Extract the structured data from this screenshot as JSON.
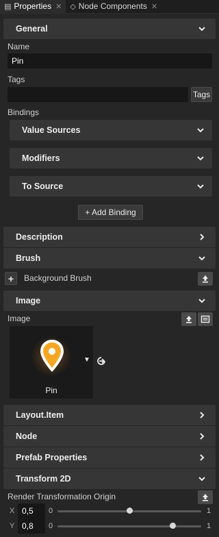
{
  "tabs": [
    {
      "label": "Properties",
      "active": true
    },
    {
      "label": "Node Components",
      "active": false
    }
  ],
  "sections": {
    "general": "General",
    "description": "Description",
    "brush": "Brush",
    "image": "Image",
    "layout_item": "Layout.Item",
    "node": "Node",
    "prefab_properties": "Prefab Properties",
    "transform_2d": "Transform 2D"
  },
  "fields": {
    "name_label": "Name",
    "name_value": "Pin",
    "tags_label": "Tags",
    "tags_value": "",
    "tags_button": "Tags",
    "bindings_label": "Bindings",
    "image_label": "Image",
    "render_origin_label": "Render Transformation Origin"
  },
  "bindings": {
    "value_sources": "Value Sources",
    "modifiers": "Modifiers",
    "to_source": "To Source",
    "add_binding": "+ Add Binding"
  },
  "brush": {
    "add_symbol": "+",
    "background_brush": "Background Brush"
  },
  "image": {
    "thumbnail_label": "Pin",
    "accent_color": "#f5a623"
  },
  "transform": {
    "x_label": "X",
    "y_label": "Y",
    "x_value": "0,5",
    "y_value": "0,8",
    "slider_min": "0",
    "slider_max": "1",
    "x_level": 0.5,
    "y_level": 0.8
  }
}
